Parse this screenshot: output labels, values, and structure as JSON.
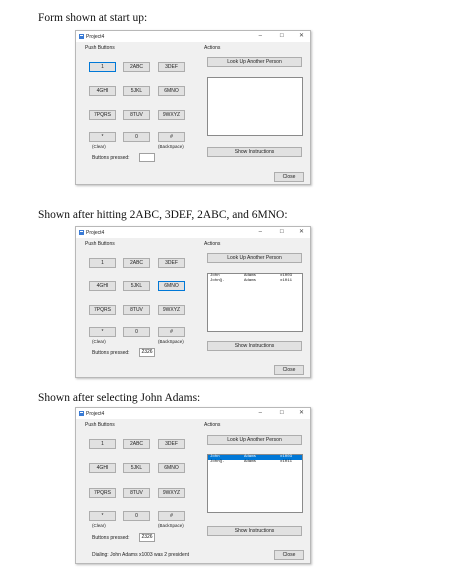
{
  "captions": [
    "Form shown at start up:",
    "Shown after hitting 2ABC, 3DEF, 2ABC, and 6MNO:",
    "Shown after selecting John Adams:"
  ],
  "window": {
    "title": "Project4",
    "min_glyph": "–",
    "max_glyph": "☐",
    "close_glyph": "✕"
  },
  "labels": {
    "push_buttons": "Push Buttons",
    "actions": "Actions",
    "clear": "(Clear)",
    "backspace": "(BackSpace)",
    "buttons_pressed": "Buttons pressed:",
    "look_up": "Look Up Another Person",
    "show_instructions": "Show Instructions",
    "close": "Close"
  },
  "keys": [
    "1",
    "2ABC",
    "3DEF",
    "4GHI",
    "5JKL",
    "6MNO",
    "7PQRS",
    "8TUV",
    "9WXYZ",
    "*",
    "0",
    "#"
  ],
  "forms": [
    {
      "pressed": "",
      "focused_key": "1",
      "list": [],
      "status": ""
    },
    {
      "pressed": "2326",
      "focused_key": "6MNO",
      "list": [
        {
          "first": "John",
          "last": "Adams",
          "ext": "x1003",
          "selected": false
        },
        {
          "first": "JohnQ.",
          "last": "Adams",
          "ext": "x1011",
          "selected": false
        }
      ],
      "status": ""
    },
    {
      "pressed": "2326",
      "focused_key": "",
      "list": [
        {
          "first": "John",
          "last": "Adams",
          "ext": "x1003",
          "selected": true
        },
        {
          "first": "JohnQ.",
          "last": "Adams",
          "ext": "x1011",
          "selected": false
        }
      ],
      "status": "Dialing: John Adams x1003 was 2 president"
    }
  ],
  "colors": {
    "window_bg": "#f0f0f0",
    "button_bg": "#e1e1e1",
    "focus_border": "#0078d7",
    "selection": "#0078d7"
  },
  "icons": {
    "app": "project-app-icon"
  }
}
